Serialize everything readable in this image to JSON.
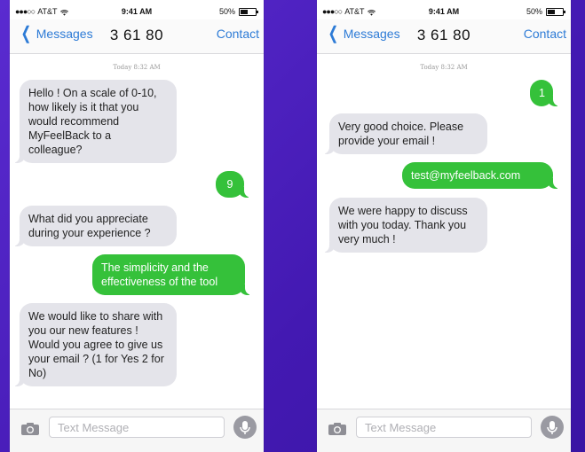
{
  "status": {
    "carrier": "AT&T",
    "time": "9:41 AM",
    "battery": "50%",
    "battery_level": 0.5
  },
  "navbar": {
    "back_label": "Messages",
    "contact_number": "3 61 80",
    "contact_label": "Contact"
  },
  "composer": {
    "placeholder": "Text Message",
    "icons": [
      "camera-icon",
      "microphone-icon"
    ]
  },
  "colors": {
    "background": "#4a1fb8",
    "incoming": "#e4e4ea",
    "outgoing": "#35c13a",
    "link": "#2d7bd6"
  },
  "left": {
    "timestamp": "Today 8:32 AM",
    "messages": [
      {
        "dir": "in",
        "text": "Hello ! On a scale of 0-10, how likely is it that you would recommend MyFeelBack to a colleague?"
      },
      {
        "dir": "out",
        "text": "9"
      },
      {
        "dir": "in",
        "text": "What did you appreciate during your experience ?"
      },
      {
        "dir": "out",
        "text": "The simplicity and the effectiveness of the tool"
      },
      {
        "dir": "in",
        "text": "We would like to share with you our new features ! Would you agree to give us your email ? (1 for Yes 2 for No)"
      }
    ]
  },
  "right": {
    "timestamp": "Today 8:32 AM",
    "messages": [
      {
        "dir": "out",
        "text": "1"
      },
      {
        "dir": "in",
        "text": "Very good choice. Please provide your email !"
      },
      {
        "dir": "out",
        "text": "test@myfeelback.com"
      },
      {
        "dir": "in",
        "text": "We were happy to discuss with you today. Thank you very much !"
      }
    ]
  }
}
